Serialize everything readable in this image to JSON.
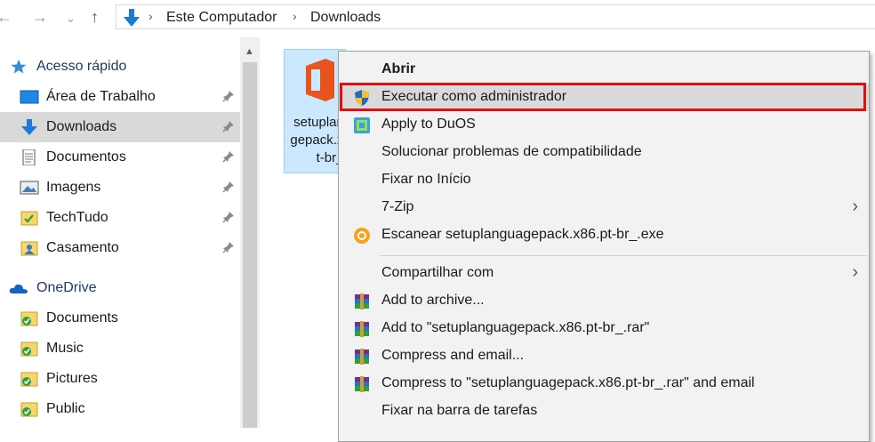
{
  "breadcrumb": {
    "root": "Este Computador",
    "current": "Downloads"
  },
  "sidebar": {
    "quick_access": "Acesso rápido",
    "quick_items": [
      {
        "label": "Área de Trabalho",
        "icon": "desktop-icon"
      },
      {
        "label": "Downloads",
        "icon": "download-arrow-icon"
      },
      {
        "label": "Documentos",
        "icon": "document-icon"
      },
      {
        "label": "Imagens",
        "icon": "image-icon"
      },
      {
        "label": "TechTudo",
        "icon": "folder-icon"
      },
      {
        "label": "Casamento",
        "icon": "folder-icon"
      }
    ],
    "onedrive": "OneDrive",
    "onedrive_items": [
      {
        "label": "Documents",
        "icon": "folder-sync-icon"
      },
      {
        "label": "Music",
        "icon": "folder-sync-icon"
      },
      {
        "label": "Pictures",
        "icon": "folder-sync-icon"
      },
      {
        "label": "Public",
        "icon": "folder-sync-icon"
      }
    ]
  },
  "file": {
    "name": "setuplanguagepack.x86.pt-br_"
  },
  "context_menu": {
    "items": [
      {
        "label": "Abrir"
      },
      {
        "label": "Executar como administrador"
      },
      {
        "label": "Apply to DuOS"
      },
      {
        "label": "Solucionar problemas de compatibilidade"
      },
      {
        "label": "Fixar no Início"
      },
      {
        "label": "7-Zip"
      },
      {
        "label": "Escanear setuplanguagepack.x86.pt-br_.exe"
      },
      {
        "label": "Compartilhar com"
      },
      {
        "label": "Add to archive..."
      },
      {
        "label": "Add to \"setuplanguagepack.x86.pt-br_.rar\""
      },
      {
        "label": "Compress and email..."
      },
      {
        "label": "Compress to \"setuplanguagepack.x86.pt-br_.rar\" and email"
      },
      {
        "label": "Fixar na barra de tarefas"
      }
    ]
  },
  "colors": {
    "highlight_box": "#e01010",
    "selected_bg": "#d9d9d9",
    "file_selected_bg": "#cce8ff",
    "menu_bg": "#f2f2f2"
  }
}
